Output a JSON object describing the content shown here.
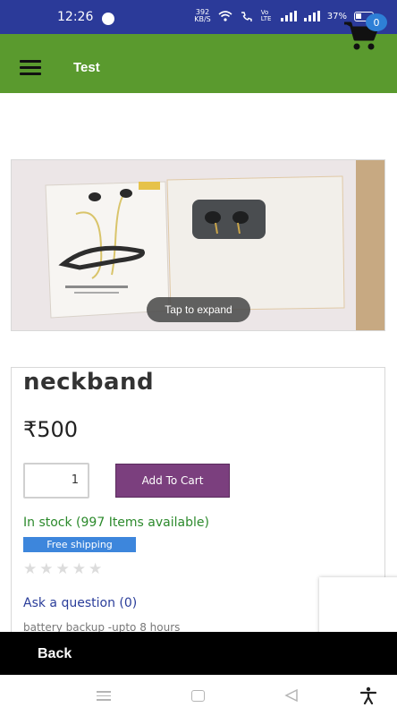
{
  "status_bar": {
    "time": "12:26",
    "speed_value": "392",
    "speed_unit": "KB/S",
    "network_label": "Vo LTE",
    "battery": "37%"
  },
  "app_bar": {
    "title": "Test",
    "cart_count": "0"
  },
  "image": {
    "tap_label": "Tap to expand"
  },
  "product": {
    "name": "neckband",
    "price": "₹500",
    "quantity": "1",
    "add_to_cart_label": "Add To Cart",
    "stock": "In stock (997 Items available)",
    "shipping_badge": "Free shipping",
    "rating_stars": 0,
    "ask_question": "Ask a question (0)",
    "description": "battery backup -upto 8 hours"
  },
  "footer": {
    "back_label": "Back"
  },
  "colors": {
    "status_bar": "#2b3a99",
    "app_bar": "#5a9a2e",
    "add_to_cart": "#7b3f7e",
    "stock_text": "#2c8a2c",
    "shipping_badge": "#3d86dc",
    "link": "#2a3d9a"
  }
}
